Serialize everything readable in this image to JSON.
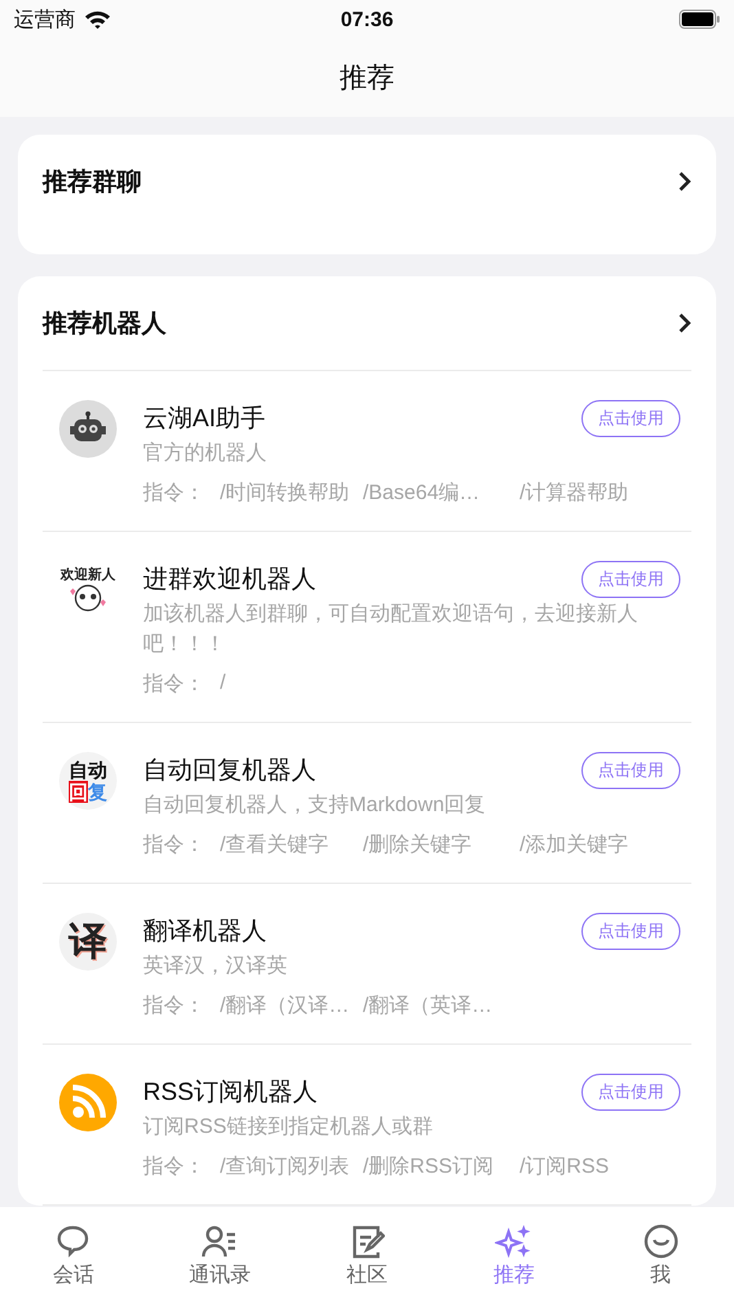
{
  "status_bar": {
    "carrier": "运营商",
    "time": "07:36"
  },
  "nav": {
    "title": "推荐"
  },
  "group_card": {
    "title": "推荐群聊"
  },
  "robot_card": {
    "title": "推荐机器人",
    "robots": [
      {
        "avatar": {
          "kind": "robot"
        },
        "name": "云湖AI助手",
        "use_button": "点击使用",
        "command_label": "指令：",
        "description": "官方的机器人",
        "commands": [
          "/时间转换帮助",
          "/Base64编…",
          "/计算器帮助"
        ]
      },
      {
        "avatar": {
          "kind": "sticker",
          "text": "欢迎新人"
        },
        "name": "进群欢迎机器人",
        "use_button": "点击使用",
        "command_label": "指令：",
        "description": "加该机器人到群聊，可自动配置欢迎语句，去迎接新人吧！！！",
        "commands": [
          "/"
        ]
      },
      {
        "avatar": {
          "kind": "twoline",
          "line1": "自动",
          "line2": "回复"
        },
        "name": "自动回复机器人",
        "use_button": "点击使用",
        "command_label": "指令：",
        "description": "自动回复机器人，支持Markdown回复",
        "commands": [
          "/查看关键字",
          "/删除关键字",
          "/添加关键字"
        ]
      },
      {
        "avatar": {
          "kind": "glyph",
          "text": "译"
        },
        "name": "翻译机器人",
        "use_button": "点击使用",
        "command_label": "指令：",
        "description": "英译汉，汉译英",
        "commands": [
          "/翻译（汉译…",
          "/翻译（英译…"
        ]
      },
      {
        "avatar": {
          "kind": "rss"
        },
        "name": "RSS订阅机器人",
        "use_button": "点击使用",
        "command_label": "指令：",
        "description": "订阅RSS链接到指定机器人或群",
        "commands": [
          "/查询订阅列表",
          "/删除RSS订阅",
          "/订阅RSS"
        ]
      }
    ]
  },
  "tab_bar": [
    {
      "label": "会话",
      "kind": "chat",
      "selected": false
    },
    {
      "label": "通讯录",
      "kind": "contacts",
      "selected": false
    },
    {
      "label": "社区",
      "kind": "edit",
      "selected": false
    },
    {
      "label": "推荐",
      "kind": "sparkle",
      "selected": true
    },
    {
      "label": "我",
      "kind": "smile",
      "selected": false
    }
  ]
}
